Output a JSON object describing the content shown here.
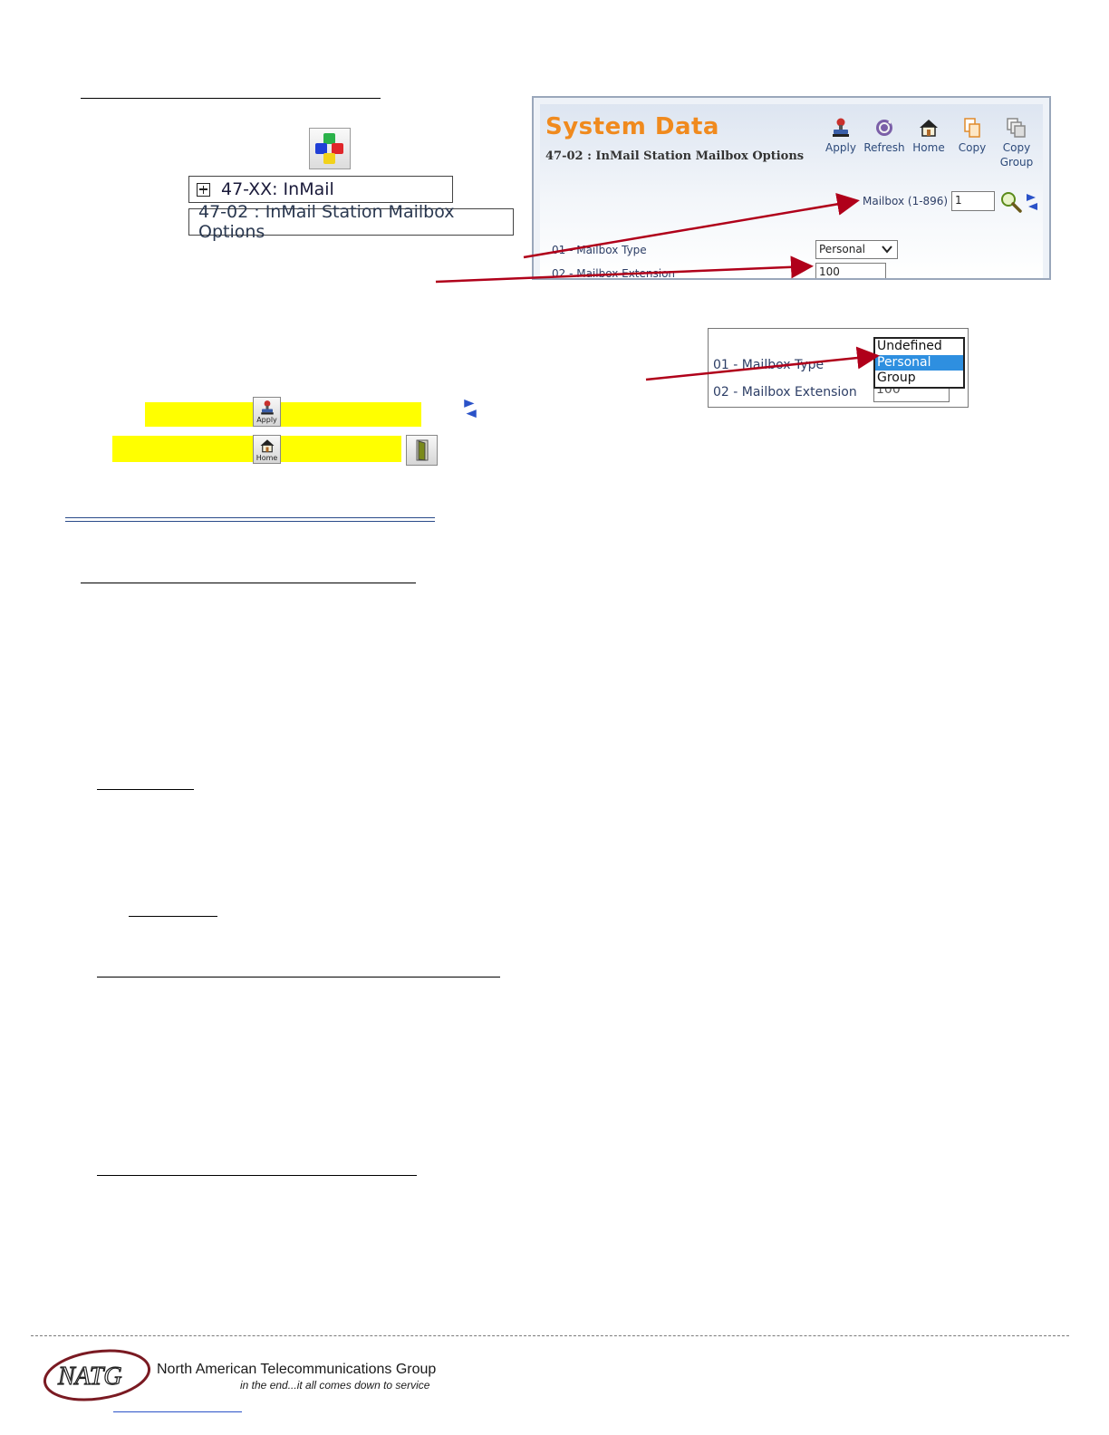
{
  "nav": {
    "tree_item": "47-XX: InMail",
    "selected_item": "47-02 : InMail Station Mailbox Options"
  },
  "system_data": {
    "title": "System Data",
    "subtitle": "47-02 : InMail Station Mailbox Options",
    "toolbar": {
      "apply": "Apply",
      "refresh": "Refresh",
      "home": "Home",
      "copy": "Copy",
      "copy_group_line1": "Copy",
      "copy_group_line2": "Group"
    },
    "mailbox_label": "Mailbox (1-896)",
    "mailbox_value": "1",
    "field1_label": "01 - Mailbox Type",
    "field1_value": "Personal",
    "field2_label": "02 - Mailbox Extension",
    "field2_value": "100"
  },
  "dropdown_view": {
    "field1_label": "01 - Mailbox Type",
    "field2_label": "02 - Mailbox Extension",
    "options": [
      "Undefined",
      "Personal",
      "Group"
    ],
    "selected": "Personal",
    "field2_value": "100"
  },
  "buttons": {
    "apply_small": "Apply",
    "home_small": "Home"
  },
  "footer": {
    "company": "North American Telecommunications Group",
    "tagline": "in the end...it all comes down to service",
    "logo_text": "NATG"
  },
  "colors": {
    "accent_orange": "#f08a1e",
    "arrow_red": "#b0001a",
    "highlight": "#ffff00",
    "selected_blue": "#2e8fe0"
  }
}
